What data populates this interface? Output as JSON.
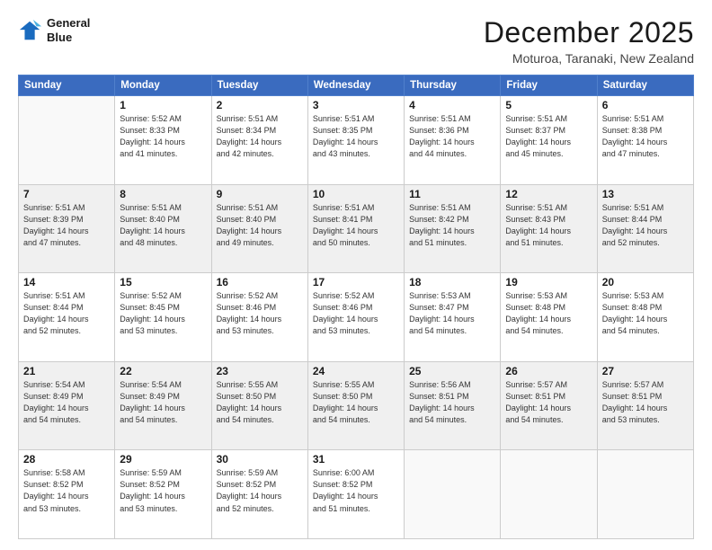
{
  "logo": {
    "line1": "General",
    "line2": "Blue"
  },
  "title": "December 2025",
  "subtitle": "Moturoa, Taranaki, New Zealand",
  "days_of_week": [
    "Sunday",
    "Monday",
    "Tuesday",
    "Wednesday",
    "Thursday",
    "Friday",
    "Saturday"
  ],
  "weeks": [
    [
      {
        "day": "",
        "info": ""
      },
      {
        "day": "1",
        "info": "Sunrise: 5:52 AM\nSunset: 8:33 PM\nDaylight: 14 hours\nand 41 minutes."
      },
      {
        "day": "2",
        "info": "Sunrise: 5:51 AM\nSunset: 8:34 PM\nDaylight: 14 hours\nand 42 minutes."
      },
      {
        "day": "3",
        "info": "Sunrise: 5:51 AM\nSunset: 8:35 PM\nDaylight: 14 hours\nand 43 minutes."
      },
      {
        "day": "4",
        "info": "Sunrise: 5:51 AM\nSunset: 8:36 PM\nDaylight: 14 hours\nand 44 minutes."
      },
      {
        "day": "5",
        "info": "Sunrise: 5:51 AM\nSunset: 8:37 PM\nDaylight: 14 hours\nand 45 minutes."
      },
      {
        "day": "6",
        "info": "Sunrise: 5:51 AM\nSunset: 8:38 PM\nDaylight: 14 hours\nand 47 minutes."
      }
    ],
    [
      {
        "day": "7",
        "info": "Sunrise: 5:51 AM\nSunset: 8:39 PM\nDaylight: 14 hours\nand 47 minutes."
      },
      {
        "day": "8",
        "info": "Sunrise: 5:51 AM\nSunset: 8:40 PM\nDaylight: 14 hours\nand 48 minutes."
      },
      {
        "day": "9",
        "info": "Sunrise: 5:51 AM\nSunset: 8:40 PM\nDaylight: 14 hours\nand 49 minutes."
      },
      {
        "day": "10",
        "info": "Sunrise: 5:51 AM\nSunset: 8:41 PM\nDaylight: 14 hours\nand 50 minutes."
      },
      {
        "day": "11",
        "info": "Sunrise: 5:51 AM\nSunset: 8:42 PM\nDaylight: 14 hours\nand 51 minutes."
      },
      {
        "day": "12",
        "info": "Sunrise: 5:51 AM\nSunset: 8:43 PM\nDaylight: 14 hours\nand 51 minutes."
      },
      {
        "day": "13",
        "info": "Sunrise: 5:51 AM\nSunset: 8:44 PM\nDaylight: 14 hours\nand 52 minutes."
      }
    ],
    [
      {
        "day": "14",
        "info": "Sunrise: 5:51 AM\nSunset: 8:44 PM\nDaylight: 14 hours\nand 52 minutes."
      },
      {
        "day": "15",
        "info": "Sunrise: 5:52 AM\nSunset: 8:45 PM\nDaylight: 14 hours\nand 53 minutes."
      },
      {
        "day": "16",
        "info": "Sunrise: 5:52 AM\nSunset: 8:46 PM\nDaylight: 14 hours\nand 53 minutes."
      },
      {
        "day": "17",
        "info": "Sunrise: 5:52 AM\nSunset: 8:46 PM\nDaylight: 14 hours\nand 53 minutes."
      },
      {
        "day": "18",
        "info": "Sunrise: 5:53 AM\nSunset: 8:47 PM\nDaylight: 14 hours\nand 54 minutes."
      },
      {
        "day": "19",
        "info": "Sunrise: 5:53 AM\nSunset: 8:48 PM\nDaylight: 14 hours\nand 54 minutes."
      },
      {
        "day": "20",
        "info": "Sunrise: 5:53 AM\nSunset: 8:48 PM\nDaylight: 14 hours\nand 54 minutes."
      }
    ],
    [
      {
        "day": "21",
        "info": "Sunrise: 5:54 AM\nSunset: 8:49 PM\nDaylight: 14 hours\nand 54 minutes."
      },
      {
        "day": "22",
        "info": "Sunrise: 5:54 AM\nSunset: 8:49 PM\nDaylight: 14 hours\nand 54 minutes."
      },
      {
        "day": "23",
        "info": "Sunrise: 5:55 AM\nSunset: 8:50 PM\nDaylight: 14 hours\nand 54 minutes."
      },
      {
        "day": "24",
        "info": "Sunrise: 5:55 AM\nSunset: 8:50 PM\nDaylight: 14 hours\nand 54 minutes."
      },
      {
        "day": "25",
        "info": "Sunrise: 5:56 AM\nSunset: 8:51 PM\nDaylight: 14 hours\nand 54 minutes."
      },
      {
        "day": "26",
        "info": "Sunrise: 5:57 AM\nSunset: 8:51 PM\nDaylight: 14 hours\nand 54 minutes."
      },
      {
        "day": "27",
        "info": "Sunrise: 5:57 AM\nSunset: 8:51 PM\nDaylight: 14 hours\nand 53 minutes."
      }
    ],
    [
      {
        "day": "28",
        "info": "Sunrise: 5:58 AM\nSunset: 8:52 PM\nDaylight: 14 hours\nand 53 minutes."
      },
      {
        "day": "29",
        "info": "Sunrise: 5:59 AM\nSunset: 8:52 PM\nDaylight: 14 hours\nand 53 minutes."
      },
      {
        "day": "30",
        "info": "Sunrise: 5:59 AM\nSunset: 8:52 PM\nDaylight: 14 hours\nand 52 minutes."
      },
      {
        "day": "31",
        "info": "Sunrise: 6:00 AM\nSunset: 8:52 PM\nDaylight: 14 hours\nand 51 minutes."
      },
      {
        "day": "",
        "info": ""
      },
      {
        "day": "",
        "info": ""
      },
      {
        "day": "",
        "info": ""
      }
    ]
  ]
}
